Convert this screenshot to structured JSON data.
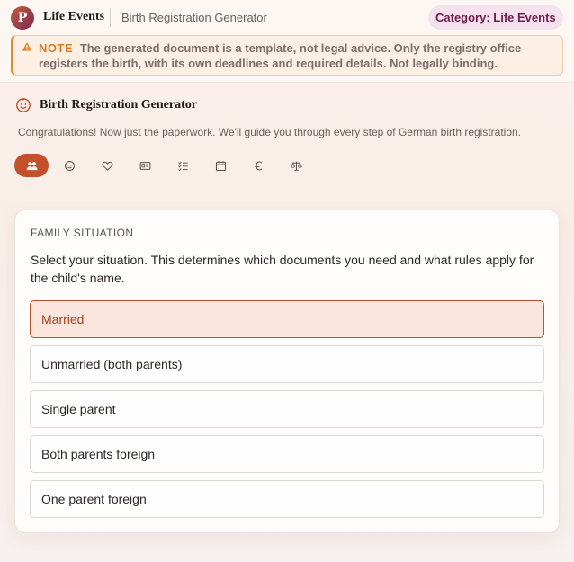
{
  "header": {
    "logo_letter": "P",
    "brand": "Life Events",
    "breadcrumb": "Birth Registration Generator",
    "category_badge": "Category: Life Events"
  },
  "notice": {
    "label": "NOTE",
    "text": "The generated document is a template, not legal advice. Only the registry office registers the birth, with its own deadlines and required details. Not legally binding."
  },
  "main": {
    "title": "Birth Registration Generator",
    "intro": "Congratulations! Now just the paperwork. We'll guide you through every step of German birth registration."
  },
  "tabs": [
    {
      "icon": "people-icon",
      "active": true
    },
    {
      "icon": "baby-icon",
      "active": false
    },
    {
      "icon": "heart-icon",
      "active": false
    },
    {
      "icon": "id-card-icon",
      "active": false
    },
    {
      "icon": "checklist-icon",
      "active": false
    },
    {
      "icon": "calendar-icon",
      "active": false
    },
    {
      "icon": "euro-icon",
      "active": false
    },
    {
      "icon": "scales-icon",
      "active": false
    }
  ],
  "family": {
    "section_label": "FAMILY SITUATION",
    "description": "Select your situation. This determines which documents you need and what rules apply for the child's name.",
    "selected": "Married",
    "options": [
      "Married",
      "Unmarried (both parents)",
      "Single parent",
      "Both parents foreign",
      "One parent foreign"
    ]
  },
  "colors": {
    "accent": "#c2502a",
    "notice_accent": "#e08a2e",
    "badge_text": "#6e1e4e"
  }
}
